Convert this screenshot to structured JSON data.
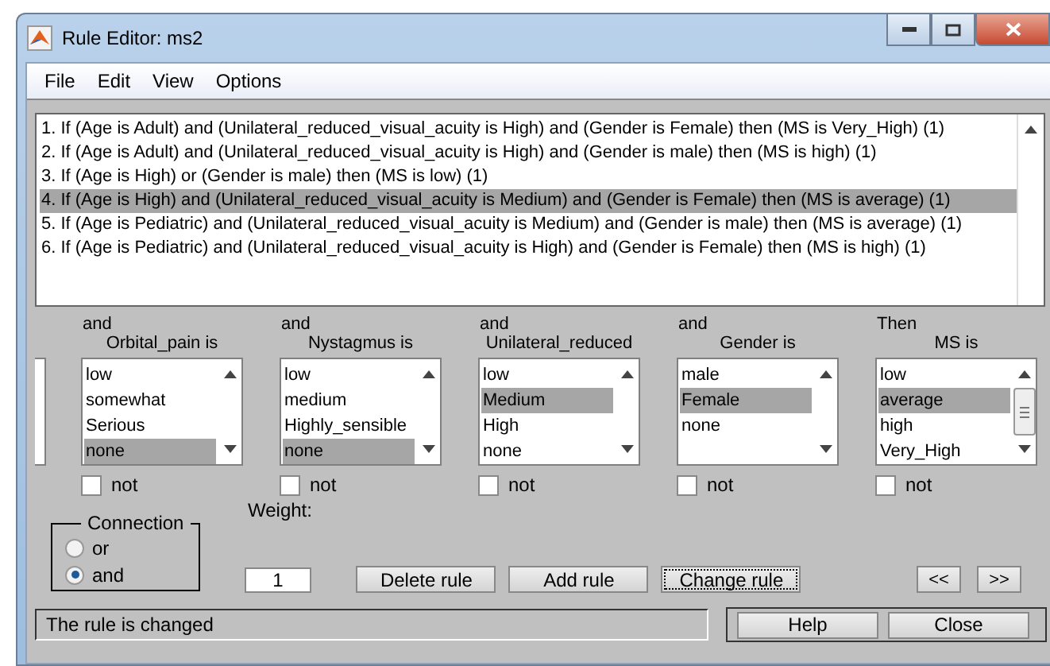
{
  "window": {
    "title": "Rule Editor: ms2"
  },
  "menu": [
    "File",
    "Edit",
    "View",
    "Options"
  ],
  "rules": [
    {
      "text": "1. If (Age is Adult) and (Unilateral_reduced_visual_acuity is High) and (Gender is Female) then (MS is Very_High) (1)",
      "selected": false
    },
    {
      "text": "2. If (Age is Adult) and (Unilateral_reduced_visual_acuity is High) and (Gender is male) then (MS is high) (1)",
      "selected": false
    },
    {
      "text": "3. If (Age is High) or (Gender is male) then (MS is low) (1)",
      "selected": false
    },
    {
      "text": "4. If (Age is High) and (Unilateral_reduced_visual_acuity is Medium) and (Gender is Female) then (MS is average) (1)",
      "selected": true
    },
    {
      "text": "5. If (Age is Pediatric) and (Unilateral_reduced_visual_acuity is Medium) and (Gender is male) then (MS is average) (1)",
      "selected": false
    },
    {
      "text": "6. If (Age is Pediatric) and (Unilateral_reduced_visual_acuity is High) and (Gender is Female) then (MS is high) (1)",
      "selected": false
    }
  ],
  "columns": [
    {
      "connector": "and",
      "header": "Orbital_pain is",
      "not_label": "not",
      "not": false,
      "items": [
        {
          "label": "low",
          "selected": false
        },
        {
          "label": "somewhat",
          "selected": false
        },
        {
          "label": "Serious",
          "selected": false
        },
        {
          "label": "none",
          "selected": true
        }
      ]
    },
    {
      "connector": "and",
      "header": "Nystagmus is",
      "not_label": "not",
      "not": false,
      "items": [
        {
          "label": "low",
          "selected": false
        },
        {
          "label": "medium",
          "selected": false
        },
        {
          "label": "Highly_sensible",
          "selected": false
        },
        {
          "label": "none",
          "selected": true
        }
      ]
    },
    {
      "connector": "and",
      "header": "Unilateral_reduced",
      "not_label": "not",
      "not": false,
      "items": [
        {
          "label": "low",
          "selected": false
        },
        {
          "label": "Medium",
          "selected": true
        },
        {
          "label": "High",
          "selected": false
        },
        {
          "label": "none",
          "selected": false
        }
      ]
    },
    {
      "connector": "and",
      "header": "Gender is",
      "not_label": "not",
      "not": false,
      "items": [
        {
          "label": "male",
          "selected": false
        },
        {
          "label": "Female",
          "selected": true
        },
        {
          "label": "none",
          "selected": false
        }
      ]
    },
    {
      "connector": "Then",
      "header": "MS is",
      "not_label": "not",
      "not": false,
      "items": [
        {
          "label": "low",
          "selected": false
        },
        {
          "label": "average",
          "selected": true
        },
        {
          "label": "high",
          "selected": false
        },
        {
          "label": "Very_High",
          "selected": false
        }
      ]
    }
  ],
  "connection": {
    "title": "Connection",
    "options": [
      {
        "label": "or",
        "selected": false
      },
      {
        "label": "and",
        "selected": true
      }
    ]
  },
  "weight": {
    "label": "Weight:",
    "value": "1"
  },
  "buttons": [
    {
      "label": "Delete rule",
      "focused": false
    },
    {
      "label": "Add rule",
      "focused": false
    },
    {
      "label": "Change rule",
      "focused": true
    }
  ],
  "nav_buttons": [
    "<<",
    ">>"
  ],
  "status": "The rule is changed",
  "footer_buttons": [
    "Help",
    "Close"
  ]
}
